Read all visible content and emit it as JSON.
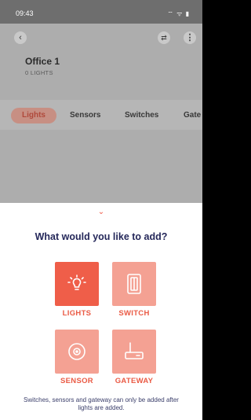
{
  "status_bar": {
    "time": "09:43",
    "icons": "⌔ ᯤ ▮"
  },
  "header": {
    "back_icon": "‹",
    "filter_icon": "⇄",
    "more_icon": "⋮",
    "room_name": "Office 1",
    "room_subtitle": "0 LIGHTS"
  },
  "tabs": [
    {
      "label": "Lights",
      "active": true
    },
    {
      "label": "Sensors",
      "active": false
    },
    {
      "label": "Switches",
      "active": false
    },
    {
      "label": "Gate",
      "active": false
    }
  ],
  "sheet": {
    "chevron": "⌄",
    "title": "What would you like to add?",
    "options": [
      {
        "label": "LIGHTS",
        "icon": "bulb-icon"
      },
      {
        "label": "SWITCH",
        "icon": "switch-icon"
      },
      {
        "label": "SENSOR",
        "icon": "sensor-icon"
      },
      {
        "label": "GATEWAY",
        "icon": "gateway-icon"
      }
    ],
    "note": "Switches, sensors and gateway can only be added after lights are added."
  },
  "colors": {
    "accent": "#ef5e49",
    "accent_light": "#f4a193",
    "title_text": "#25285a"
  }
}
